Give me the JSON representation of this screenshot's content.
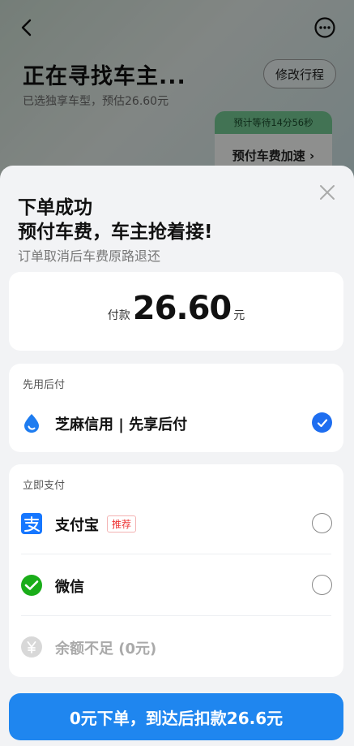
{
  "background": {
    "status_title": "正在寻找车主...",
    "status_sub": "已选独享车型，预估26.60元",
    "modify_label": "修改行程",
    "wait_text": "预计等待14分56秒",
    "prepay_boost_label": "预付车费加速 ›"
  },
  "sheet": {
    "title_line1": "下单成功",
    "title_line2": "预付车费，车主抢着接!",
    "subtitle": "订单取消后车费原路退还",
    "pay": {
      "label": "付款",
      "amount": "26.60",
      "unit": "元"
    },
    "later_section": {
      "label": "先用后付",
      "option": {
        "text": "芝麻信用 | 先享后付",
        "checked": true
      }
    },
    "now_section": {
      "label": "立即支付",
      "options": [
        {
          "text": "支付宝",
          "badge": "推荐",
          "checked": false
        },
        {
          "text": "微信",
          "checked": false
        },
        {
          "text": "余额不足 (0元)",
          "disabled": true
        }
      ]
    },
    "confirm_label": "0元下单，到达后扣款26.6元"
  },
  "colors": {
    "accent": "#1f86ef",
    "check": "#1e6ef0",
    "badge": "#e33333",
    "wechat": "#1aad19",
    "alipay": "#1677ff"
  }
}
